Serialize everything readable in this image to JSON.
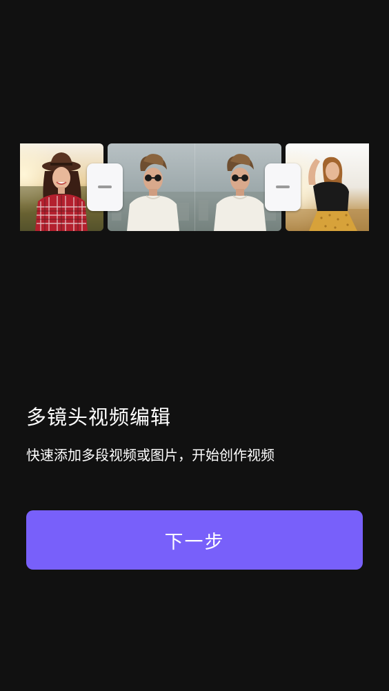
{
  "timeline": {
    "clips": [
      {
        "name": "clip-woman-hat"
      },
      {
        "name": "clip-man-sunglasses"
      },
      {
        "name": "clip-woman-field"
      }
    ]
  },
  "intro": {
    "title": "多镜头视频编辑",
    "description": "快速添加多段视频或图片，开始创作视频"
  },
  "actions": {
    "next_label": "下一步"
  },
  "colors": {
    "background": "#111111",
    "accent": "#7860fa",
    "handle": "#f7f7f9"
  }
}
